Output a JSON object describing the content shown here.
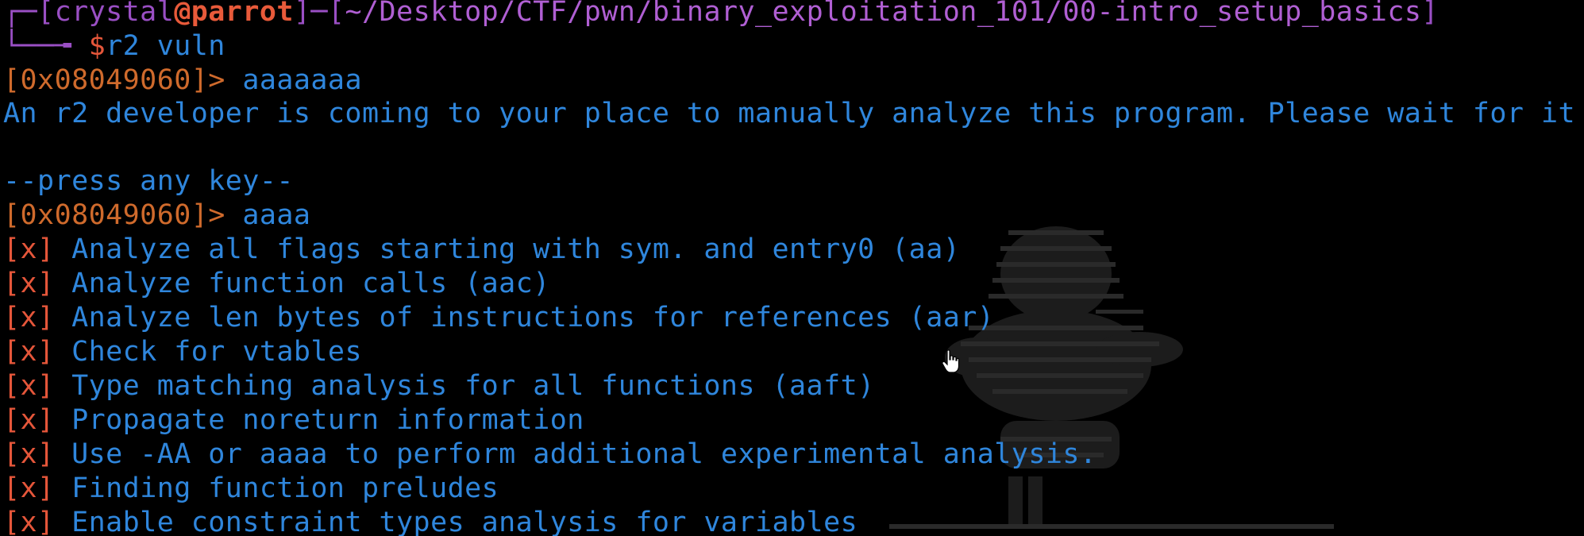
{
  "prompt": {
    "user": "crystal",
    "at": "@",
    "host": "parrot",
    "cwd": "~/Desktop/CTF/pwn/binary_exploitation_101/00-intro_setup_basics",
    "symbol": "$",
    "command": "r2 vuln"
  },
  "session": {
    "address": "[0x08049060]>",
    "cmd1": "aaaaaaa",
    "message": "An r2 developer is coming to your place to manually analyze this program. Please wait for it",
    "press_key": "--press any key--",
    "cmd2": "aaaa"
  },
  "analysis_mark": "[x]",
  "analysis": [
    "Analyze all flags starting with sym. and entry0 (aa)",
    "Analyze function calls (aac)",
    "Analyze len bytes of instructions for references (aar)",
    "Check for vtables",
    "Type matching analysis for all functions (aaft)",
    "Propagate noreturn information",
    "Use -AA or aaaa to perform additional experimental analysis.",
    "Finding function preludes",
    "Enable constraint types analysis for variables"
  ],
  "colors": {
    "background": "#000000",
    "prompt_frame": "#9a4fc4",
    "host": "#e85a3a",
    "path": "#b05fd3",
    "text_blue": "#2f86dc",
    "address": "#cf6a2c",
    "mark": "#e5563a"
  },
  "icons": {
    "cursor": "hand-pointer-icon",
    "background": "parrot-logo-ascii-art"
  }
}
